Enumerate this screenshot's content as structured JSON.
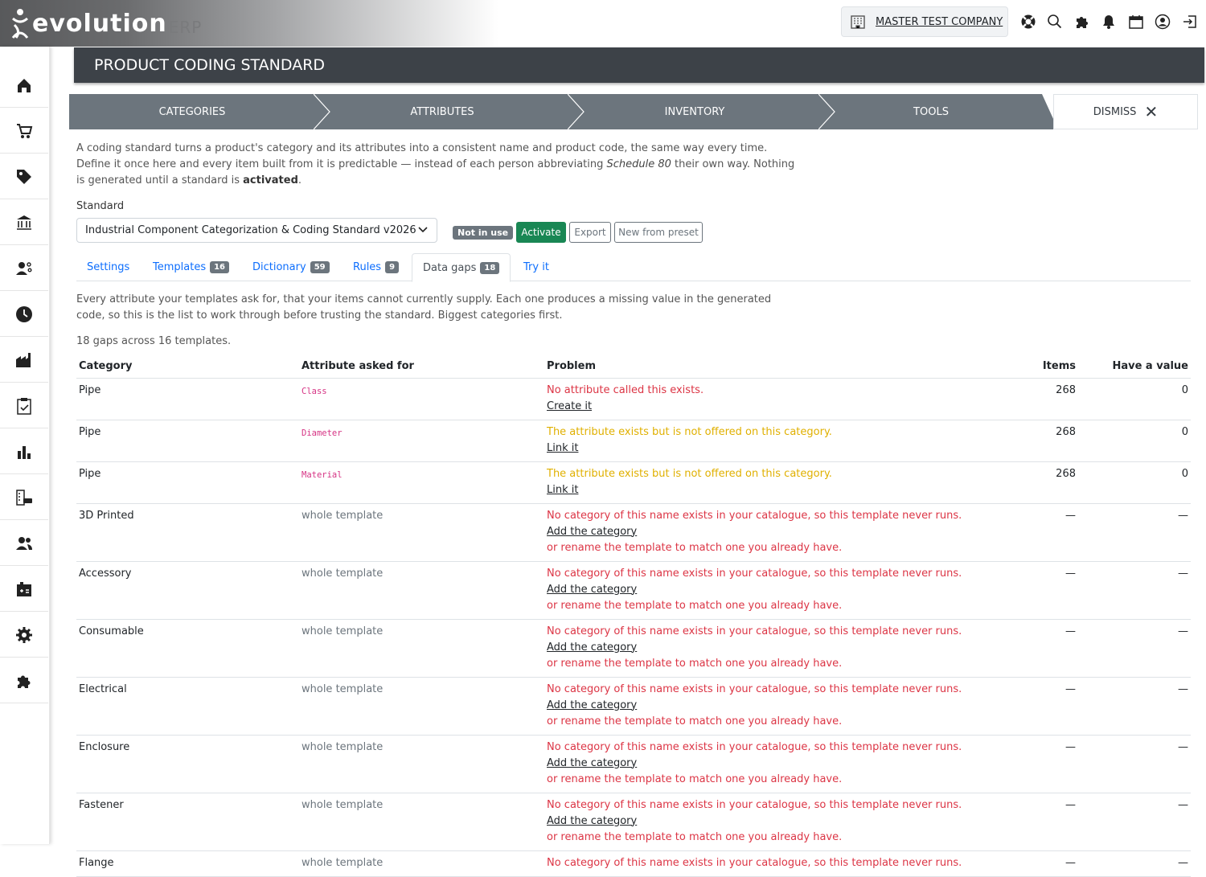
{
  "brand": {
    "name": "evolution",
    "suffix": "ERP"
  },
  "company": {
    "name": "MASTER TEST COMPANY"
  },
  "top_icons": [
    "support-icon",
    "search-icon",
    "puzzle-icon",
    "bell-icon",
    "calendar-icon",
    "user-icon",
    "logout-icon"
  ],
  "sidebar_icons": [
    "home-icon",
    "cart-icon",
    "tag-icon",
    "bank-icon",
    "people-settings-icon",
    "clock-icon",
    "factory-icon",
    "clipboard-check-icon",
    "bar-chart-icon",
    "building-car-icon",
    "users-icon",
    "calculator-icon",
    "gear-icon",
    "puzzle-icon"
  ],
  "page_title": "PRODUCT CODING STANDARD",
  "steps": [
    "CATEGORIES",
    "ATTRIBUTES",
    "INVENTORY",
    "TOOLS"
  ],
  "dismiss_label": "DISMISS",
  "intro": {
    "line1": "A coding standard turns a product's category and its attributes into a consistent name and product code, the same way every time.",
    "line2_pre": "Define it once here and every item built from it is predictable — instead of each person abbreviating ",
    "line2_em": "Schedule 80",
    "line2_post": " their own way. Nothing",
    "line3_pre": "is generated until a standard is ",
    "line3_strong": "activated",
    "line3_post": "."
  },
  "standard": {
    "label": "Standard",
    "value": "Industrial Component Categorization & Coding Standard v2026",
    "status": "Not in use",
    "activate": "Activate",
    "export": "Export",
    "new_from_preset": "New from preset"
  },
  "tabs": [
    {
      "label": "Settings",
      "count": ""
    },
    {
      "label": "Templates",
      "count": "16"
    },
    {
      "label": "Dictionary",
      "count": "59"
    },
    {
      "label": "Rules",
      "count": "9"
    },
    {
      "label": "Data gaps",
      "count": "18"
    },
    {
      "label": "Try it",
      "count": ""
    }
  ],
  "gaps": {
    "desc1": "Every attribute your templates ask for, that your items cannot currently supply. Each one produces a missing value in the generated",
    "desc2": "code, so this is the list to work through before trusting the standard. Biggest categories first.",
    "summary": "18 gaps across 16 templates.",
    "columns": [
      "Category",
      "Attribute asked for",
      "Problem",
      "Items",
      "Have a value"
    ],
    "rows": [
      {
        "category": "Pipe",
        "attribute": "Class",
        "problem": "No attribute called this exists.",
        "action": "Create it",
        "or": "",
        "items": "268",
        "have": "0",
        "severity": "red"
      },
      {
        "category": "Pipe",
        "attribute": "Diameter",
        "problem": "The attribute exists but is not offered on this category.",
        "action": "Link it",
        "or": "",
        "items": "268",
        "have": "0",
        "severity": "yellow"
      },
      {
        "category": "Pipe",
        "attribute": "Material",
        "problem": "The attribute exists but is not offered on this category.",
        "action": "Link it",
        "or": "",
        "items": "268",
        "have": "0",
        "severity": "yellow"
      },
      {
        "category": "3D Printed",
        "attribute": "whole template",
        "problem": "No category of this name exists in your catalogue, so this template never runs.",
        "action": "Add the category",
        "or": "or rename the template to match one you already have.",
        "items": "—",
        "have": "—",
        "severity": "red"
      },
      {
        "category": "Accessory",
        "attribute": "whole template",
        "problem": "No category of this name exists in your catalogue, so this template never runs.",
        "action": "Add the category",
        "or": "or rename the template to match one you already have.",
        "items": "—",
        "have": "—",
        "severity": "red"
      },
      {
        "category": "Consumable",
        "attribute": "whole template",
        "problem": "No category of this name exists in your catalogue, so this template never runs.",
        "action": "Add the category",
        "or": "or rename the template to match one you already have.",
        "items": "—",
        "have": "—",
        "severity": "red"
      },
      {
        "category": "Electrical",
        "attribute": "whole template",
        "problem": "No category of this name exists in your catalogue, so this template never runs.",
        "action": "Add the category",
        "or": "or rename the template to match one you already have.",
        "items": "—",
        "have": "—",
        "severity": "red"
      },
      {
        "category": "Enclosure",
        "attribute": "whole template",
        "problem": "No category of this name exists in your catalogue, so this template never runs.",
        "action": "Add the category",
        "or": "or rename the template to match one you already have.",
        "items": "—",
        "have": "—",
        "severity": "red"
      },
      {
        "category": "Fastener",
        "attribute": "whole template",
        "problem": "No category of this name exists in your catalogue, so this template never runs.",
        "action": "Add the category",
        "or": "or rename the template to match one you already have.",
        "items": "—",
        "have": "—",
        "severity": "red"
      },
      {
        "category": "Flange",
        "attribute": "whole template",
        "problem": "No category of this name exists in your catalogue, so this template never runs.",
        "action": "",
        "or": "",
        "items": "—",
        "have": "—",
        "severity": "red"
      }
    ]
  }
}
